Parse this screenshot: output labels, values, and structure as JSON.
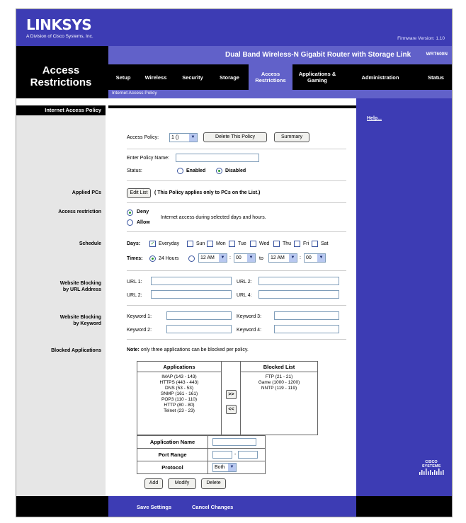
{
  "brand": {
    "logo": "LINKSYS",
    "tagline": "A Division of Cisco Systems, Inc."
  },
  "firmware": "Firmware Version: 1.10",
  "product_name": "Dual Band Wireless-N Gigabit Router with Storage Link",
  "model": "WRT600N",
  "section_title": "Access Restrictions",
  "tabs": [
    {
      "label": "Setup"
    },
    {
      "label": "Wireless"
    },
    {
      "label": "Security"
    },
    {
      "label": "Storage"
    },
    {
      "label": "Access Restrictions"
    },
    {
      "label": "Applications & Gaming"
    },
    {
      "label": "Administration"
    },
    {
      "label": "Status"
    }
  ],
  "subtab": "Internet Access Policy",
  "left_labels": {
    "header": "Internet Access Policy",
    "applied_pcs": "Applied PCs",
    "access_restriction": "Access restriction",
    "schedule": "Schedule",
    "website_url": "Website Blocking by URL Address",
    "website_keyword": "Website Blocking by Keyword",
    "blocked_apps": "Blocked Applications"
  },
  "policy": {
    "access_policy_label": "Access Policy:",
    "access_policy_value": "1 ()",
    "delete_button": "Delete This Policy",
    "summary_button": "Summary",
    "name_label": "Enter Policy Name:",
    "name_value": "",
    "status_label": "Status:",
    "enabled_label": "Enabled",
    "disabled_label": "Disabled"
  },
  "applied_pcs": {
    "edit_button": "Edit List",
    "note": "( This Policy applies only to PCs on the List.)"
  },
  "access_restriction": {
    "deny": "Deny",
    "allow": "Allow",
    "text": "Internet access during selected days and hours."
  },
  "schedule": {
    "days_label": "Days:",
    "days": [
      "Everyday",
      "Sun",
      "Mon",
      "Tue",
      "Wed",
      "Thu",
      "Fri",
      "Sat"
    ],
    "times_label": "Times:",
    "hours24": "24 Hours",
    "from_hour": "12 AM",
    "from_min": "00",
    "to_label": "to",
    "to_hour": "12 AM",
    "to_min": "00"
  },
  "url": {
    "u1": "URL 1:",
    "u2": "URL 2:",
    "u3": "URL 2:",
    "u4": "URL 4:"
  },
  "keyword": {
    "k1": "Keyword 1:",
    "k2": "Keyword 2:",
    "k3": "Keyword 3:",
    "k4": "Keyword 4:"
  },
  "apps": {
    "note_bold": "Note:",
    "note": "only three applications can be blocked per policy.",
    "applications_header": "Applications",
    "blocked_header": "Blocked List",
    "applications": [
      "IMAP (143 - 143)",
      "HTTPS (443 - 443)",
      "DNS (53 - 53)",
      "SNMP (161 - 161)",
      "POP3 (110 - 110)",
      "HTTP (80 - 80)",
      "Telnet (23 - 23)"
    ],
    "blocked": [
      "FTP (21 - 21)",
      "Game (1000 - 1200)",
      "NNTP (119 - 119)"
    ],
    "add_arrow": ">>",
    "remove_arrow": "<<",
    "app_name_label": "Application Name",
    "port_range_label": "Port Range",
    "port_sep": "-",
    "protocol_label": "Protocol",
    "protocol_value": "Both",
    "add_button": "Add",
    "modify_button": "Modify",
    "delete_button": "Delete"
  },
  "help_link": "Help...",
  "cisco_logo": "CISCO SYSTEMS",
  "footer": {
    "save": "Save Settings",
    "cancel": "Cancel Changes"
  }
}
